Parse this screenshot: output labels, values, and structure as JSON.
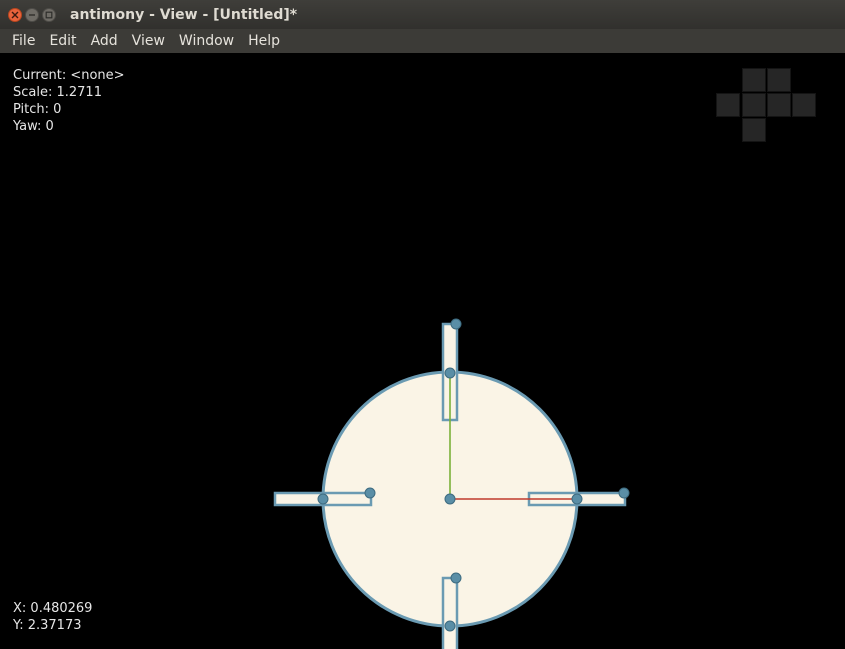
{
  "window": {
    "title": "antimony - View - [Untitled]*"
  },
  "menu": {
    "items": [
      "File",
      "Edit",
      "Add",
      "View",
      "Window",
      "Help"
    ]
  },
  "viewport": {
    "info": {
      "current": "Current: <none>",
      "scale": "Scale: 1.2711",
      "pitch": "Pitch: 0",
      "yaw": "Yaw: 0"
    },
    "coords": {
      "x": "X: 0.480269",
      "y": "Y: 2.37173"
    }
  },
  "colors": {
    "titlebar": "#3c3b37",
    "close_button": "#e9633c",
    "shape_fill": "#faf4e6",
    "shape_outline": "#6a9ab2",
    "handle": "#5a8ea6",
    "x_axis": "#c0392b",
    "y_axis": "#7ab03a",
    "cube_face": "#262626"
  },
  "icons": {
    "close": "close-icon",
    "minimize": "minimize-icon",
    "maximize": "maximize-icon"
  }
}
